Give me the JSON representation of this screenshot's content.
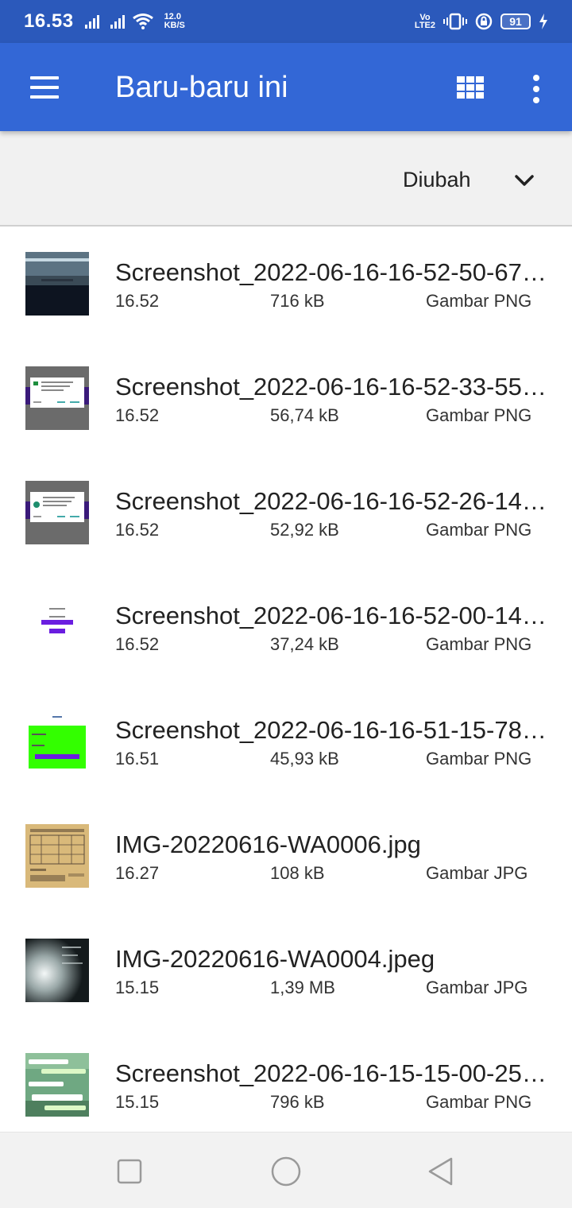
{
  "status_bar": {
    "time": "16.53",
    "net_speed_value": "12.0",
    "net_speed_unit": "KB/S",
    "volte_top": "Vo",
    "volte_bottom": "LTE2",
    "battery": "91"
  },
  "app_bar": {
    "title": "Baru-baru ini"
  },
  "sort": {
    "label": "Diubah"
  },
  "files": [
    {
      "name": "Screenshot_2022-06-16-16-52-50-67…",
      "time": "16.52",
      "size": "716 kB",
      "type": "Gambar PNG",
      "thumb": "dark-screen"
    },
    {
      "name": "Screenshot_2022-06-16-16-52-33-55…",
      "time": "16.52",
      "size": "56,74 kB",
      "type": "Gambar PNG",
      "thumb": "dialog"
    },
    {
      "name": "Screenshot_2022-06-16-16-52-26-14…",
      "time": "16.52",
      "size": "52,92 kB",
      "type": "Gambar PNG",
      "thumb": "dialog"
    },
    {
      "name": "Screenshot_2022-06-16-16-52-00-14…",
      "time": "16.52",
      "size": "37,24 kB",
      "type": "Gambar PNG",
      "thumb": "login-white"
    },
    {
      "name": "Screenshot_2022-06-16-16-51-15-78…",
      "time": "16.51",
      "size": "45,93 kB",
      "type": "Gambar PNG",
      "thumb": "login-green"
    },
    {
      "name": "IMG-20220616-WA0006.jpg",
      "time": "16.27",
      "size": "108 kB",
      "type": "Gambar JPG",
      "thumb": "paper-table"
    },
    {
      "name": "IMG-20220616-WA0004.jpeg",
      "time": "15.15",
      "size": "1,39 MB",
      "type": "Gambar JPG",
      "thumb": "dark-photo"
    },
    {
      "name": "Screenshot_2022-06-16-15-15-00-25…",
      "time": "15.15",
      "size": "796 kB",
      "type": "Gambar PNG",
      "thumb": "chat-forest"
    }
  ],
  "colors": {
    "status_bar": "#2b59bb",
    "app_bar": "#3367d6",
    "sort_bar": "#f1f1f1",
    "nav_bar": "#f2f2f2"
  },
  "icons": {
    "menu": "hamburger-menu-icon",
    "grid": "grid-view-icon",
    "more": "more-vert-icon",
    "sort": "chevron-down-icon",
    "recent": "square-recent-apps-icon",
    "home": "circle-home-icon",
    "back": "triangle-back-icon"
  }
}
